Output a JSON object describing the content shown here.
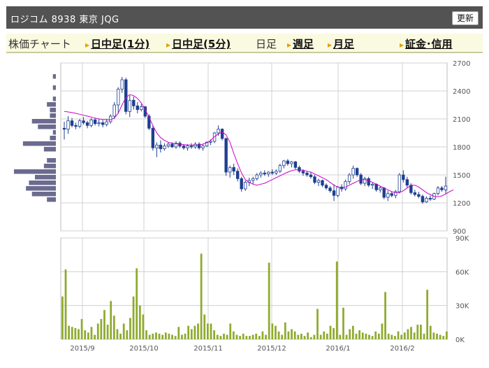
{
  "header": {
    "title": "ロジコム 8938 東京 JQG",
    "refresh_label": "更新"
  },
  "nav": {
    "chart_label": "株価チャート",
    "items": [
      {
        "label": "日中足(1分)",
        "link": true
      },
      {
        "label": "日中足(5分)",
        "link": true
      },
      {
        "label": "日足",
        "link": false
      },
      {
        "label": "週足",
        "link": true
      },
      {
        "label": "月足",
        "link": true
      },
      {
        "label": "証金･信用",
        "link": true
      }
    ]
  },
  "colors": {
    "candle": "#1f3f8f",
    "moving_average": "#cc00cc",
    "volume": "#8faa2e",
    "grid": "#d0d0d0"
  },
  "chart_data": [
    {
      "type": "candlestick",
      "ylim": [
        900,
        2700
      ],
      "y_ticks": [
        "2700",
        "2400",
        "2100",
        "1800",
        "1500",
        "1200",
        "900"
      ],
      "x_ticks": [
        "2015/9",
        "2015/10",
        "2015/11",
        "2015/12",
        "2016/1",
        "2016/2"
      ],
      "ohlc": [
        [
          2000,
          2070,
          1880,
          1990
        ],
        [
          1990,
          2130,
          1940,
          2080
        ],
        [
          2080,
          2110,
          2010,
          2030
        ],
        [
          2030,
          2060,
          1990,
          2020
        ],
        [
          2020,
          2100,
          2000,
          2080
        ],
        [
          2080,
          2120,
          2040,
          2060
        ],
        [
          2060,
          2080,
          2000,
          2030
        ],
        [
          2030,
          2110,
          2010,
          2090
        ],
        [
          2090,
          2110,
          2030,
          2050
        ],
        [
          2050,
          2100,
          2020,
          2060
        ],
        [
          2060,
          2090,
          2010,
          2040
        ],
        [
          2040,
          2100,
          2020,
          2070
        ],
        [
          2070,
          2150,
          2050,
          2130
        ],
        [
          2130,
          2280,
          2100,
          2250
        ],
        [
          2250,
          2440,
          2160,
          2420
        ],
        [
          2420,
          2550,
          2380,
          2520
        ],
        [
          2520,
          2540,
          2150,
          2180
        ],
        [
          2180,
          2350,
          2120,
          2300
        ],
        [
          2300,
          2340,
          2200,
          2240
        ],
        [
          2240,
          2280,
          2160,
          2200
        ],
        [
          2200,
          2260,
          2180,
          2230
        ],
        [
          2230,
          2240,
          2110,
          2130
        ],
        [
          2130,
          2150,
          1980,
          2000
        ],
        [
          2000,
          2030,
          1760,
          1790
        ],
        [
          1790,
          1850,
          1690,
          1820
        ],
        [
          1820,
          1870,
          1740,
          1780
        ],
        [
          1780,
          1840,
          1760,
          1810
        ],
        [
          1810,
          1850,
          1790,
          1830
        ],
        [
          1830,
          1850,
          1790,
          1800
        ],
        [
          1800,
          1860,
          1780,
          1840
        ],
        [
          1840,
          1860,
          1790,
          1810
        ],
        [
          1810,
          1830,
          1770,
          1790
        ],
        [
          1790,
          1830,
          1760,
          1810
        ],
        [
          1810,
          1840,
          1780,
          1800
        ],
        [
          1800,
          1850,
          1780,
          1830
        ],
        [
          1830,
          1850,
          1770,
          1790
        ],
        [
          1790,
          1830,
          1760,
          1810
        ],
        [
          1810,
          1860,
          1800,
          1850
        ],
        [
          1850,
          1880,
          1820,
          1860
        ],
        [
          1860,
          1960,
          1840,
          1950
        ],
        [
          1950,
          2030,
          1920,
          1990
        ],
        [
          1990,
          2000,
          1870,
          1890
        ],
        [
          1890,
          1900,
          1490,
          1530
        ],
        [
          1530,
          1600,
          1470,
          1580
        ],
        [
          1580,
          1620,
          1500,
          1540
        ],
        [
          1540,
          1570,
          1430,
          1460
        ],
        [
          1460,
          1480,
          1320,
          1350
        ],
        [
          1350,
          1440,
          1330,
          1420
        ],
        [
          1420,
          1470,
          1380,
          1440
        ],
        [
          1440,
          1480,
          1400,
          1460
        ],
        [
          1460,
          1520,
          1440,
          1500
        ],
        [
          1500,
          1540,
          1470,
          1520
        ],
        [
          1520,
          1550,
          1490,
          1510
        ],
        [
          1510,
          1540,
          1480,
          1530
        ],
        [
          1530,
          1560,
          1500,
          1520
        ],
        [
          1520,
          1560,
          1500,
          1540
        ],
        [
          1540,
          1620,
          1520,
          1600
        ],
        [
          1600,
          1660,
          1570,
          1650
        ],
        [
          1650,
          1670,
          1600,
          1620
        ],
        [
          1620,
          1650,
          1580,
          1640
        ],
        [
          1640,
          1650,
          1560,
          1580
        ],
        [
          1580,
          1600,
          1520,
          1540
        ],
        [
          1540,
          1560,
          1490,
          1520
        ],
        [
          1520,
          1540,
          1480,
          1500
        ],
        [
          1500,
          1530,
          1460,
          1480
        ],
        [
          1480,
          1500,
          1400,
          1420
        ],
        [
          1420,
          1460,
          1380,
          1440
        ],
        [
          1440,
          1450,
          1370,
          1390
        ],
        [
          1390,
          1410,
          1340,
          1360
        ],
        [
          1360,
          1380,
          1310,
          1330
        ],
        [
          1330,
          1400,
          1220,
          1280
        ],
        [
          1280,
          1380,
          1260,
          1370
        ],
        [
          1370,
          1400,
          1320,
          1350
        ],
        [
          1350,
          1450,
          1330,
          1430
        ],
        [
          1430,
          1520,
          1400,
          1500
        ],
        [
          1500,
          1600,
          1460,
          1570
        ],
        [
          1570,
          1580,
          1480,
          1500
        ],
        [
          1500,
          1520,
          1390,
          1410
        ],
        [
          1410,
          1480,
          1380,
          1460
        ],
        [
          1460,
          1480,
          1370,
          1390
        ],
        [
          1390,
          1420,
          1350,
          1400
        ],
        [
          1400,
          1410,
          1320,
          1340
        ],
        [
          1340,
          1380,
          1310,
          1360
        ],
        [
          1360,
          1370,
          1240,
          1260
        ],
        [
          1260,
          1330,
          1220,
          1300
        ],
        [
          1300,
          1320,
          1260,
          1280
        ],
        [
          1280,
          1340,
          1250,
          1320
        ],
        [
          1320,
          1520,
          1300,
          1500
        ],
        [
          1500,
          1550,
          1420,
          1450
        ],
        [
          1450,
          1480,
          1360,
          1390
        ],
        [
          1390,
          1410,
          1290,
          1310
        ],
        [
          1310,
          1340,
          1270,
          1290
        ],
        [
          1290,
          1320,
          1250,
          1270
        ],
        [
          1270,
          1290,
          1190,
          1210
        ],
        [
          1210,
          1270,
          1200,
          1250
        ],
        [
          1250,
          1280,
          1220,
          1240
        ],
        [
          1240,
          1310,
          1230,
          1300
        ],
        [
          1300,
          1380,
          1280,
          1360
        ],
        [
          1360,
          1380,
          1320,
          1340
        ],
        [
          1340,
          1480,
          1300,
          1380
        ]
      ],
      "moving_average": [
        2180,
        2175,
        2168,
        2160,
        2150,
        2140,
        2130,
        2120,
        2110,
        2100,
        2095,
        2092,
        2090,
        2110,
        2160,
        2250,
        2330,
        2360,
        2350,
        2320,
        2270,
        2200,
        2120,
        2030,
        1950,
        1900,
        1870,
        1850,
        1840,
        1835,
        1830,
        1825,
        1822,
        1820,
        1818,
        1820,
        1830,
        1845,
        1870,
        1910,
        1940,
        1960,
        1930,
        1850,
        1730,
        1620,
        1520,
        1450,
        1420,
        1400,
        1390,
        1400,
        1410,
        1430,
        1450,
        1470,
        1490,
        1510,
        1530,
        1545,
        1555,
        1555,
        1550,
        1540,
        1530,
        1510,
        1490,
        1470,
        1450,
        1420,
        1390,
        1370,
        1360,
        1370,
        1390,
        1410,
        1430,
        1450,
        1450,
        1440,
        1420,
        1400,
        1380,
        1360,
        1340,
        1320,
        1310,
        1310,
        1330,
        1360,
        1390,
        1390,
        1370,
        1340,
        1310,
        1290,
        1270,
        1265,
        1275,
        1295,
        1320,
        1340
      ]
    },
    {
      "type": "bar",
      "ylim": [
        0,
        90
      ],
      "y_ticks": [
        "90K",
        "60K",
        "30K",
        "0K"
      ],
      "values": [
        38,
        62,
        12,
        11,
        10,
        9,
        18,
        8,
        6,
        11,
        4,
        14,
        18,
        26,
        13,
        34,
        21,
        9,
        5,
        14,
        8,
        19,
        38,
        63,
        30,
        22,
        8,
        4,
        5,
        6,
        5,
        4,
        6,
        5,
        4,
        3,
        11,
        4,
        5,
        12,
        9,
        12,
        14,
        76,
        22,
        14,
        14,
        8,
        4,
        3,
        5,
        4,
        14,
        7,
        4,
        3,
        5,
        3,
        3,
        4,
        5,
        3,
        7,
        4,
        68,
        14,
        12,
        7,
        4,
        15,
        7,
        9,
        7,
        4,
        5,
        3,
        6,
        2,
        4,
        27,
        4,
        7,
        5,
        12,
        10,
        69,
        4,
        28,
        4,
        9,
        12,
        5,
        8,
        6,
        5,
        4,
        3,
        7,
        5,
        14,
        42,
        5,
        4,
        3,
        7,
        4,
        6,
        9,
        11,
        6,
        13,
        13,
        5,
        44,
        12,
        6,
        5,
        4,
        3,
        7
      ]
    }
  ]
}
